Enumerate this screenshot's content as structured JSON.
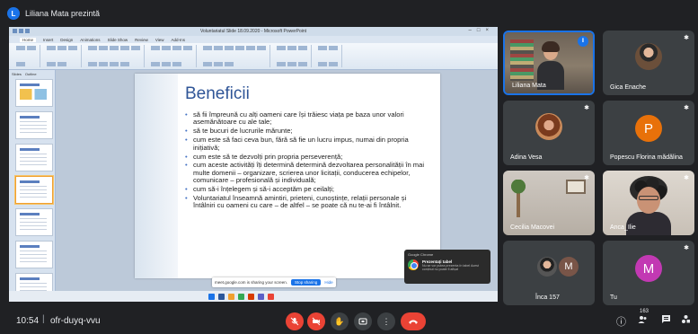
{
  "presenter": {
    "initial": "L",
    "label": "Liliana Mata prezintă"
  },
  "screen_share": {
    "window_title": "Voluntariatul Slide 18.09.2020 - Microsoft PowerPoint",
    "ribbon_tabs": [
      "Home",
      "Insert",
      "Design",
      "Animations",
      "Slide Show",
      "Review",
      "View",
      "Add-Ins"
    ],
    "panel_tabs": [
      "Slides",
      "Outline"
    ],
    "slide": {
      "title": "Beneficii",
      "bullets": [
        "să fii împreună cu alți oameni care își trăiesc viața pe baza unor valori asemănătoare cu ale tale;",
        "să te bucuri de lucrurile mărunte;",
        "cum este să faci ceva bun, fără să fie un lucru impus, numai din propria inițiativă;",
        "cum este să te dezvolți prin propria perseverență;",
        "cum aceste activități îți determină determină dezvoltarea personalității în mai multe domenii – organizare, scrierea unor licitații, conducerea echipelor, comunicare – profesională și individuală;",
        "cum să-i înțelegem și să-i acceptăm pe ceilalți;",
        "Voluntariatul înseamnă amintiri, prieteni, cunoștințe, relații personale și întâlniri cu oameni cu care – de altfel – se poate că nu te-ai fi întâlnit."
      ]
    },
    "share_banner": {
      "text": "meet.google.com is sharing your screen.",
      "stop_label": "Stop sharing",
      "hide_label": "Hide"
    },
    "notification": {
      "app": "Google Chrome",
      "title": "Prezentați tabel",
      "text": "Nu se vor putea prezenta în tabel Acest conținut nu poate fi afișat"
    },
    "taskbar_icon_colors": [
      "#1a73e8",
      "#2b579a",
      "#f0a030",
      "#34a853",
      "#d83b01",
      "#5b5fc7",
      "#ea4335"
    ]
  },
  "participants": [
    {
      "name": "Liliana Mata",
      "type": "camera",
      "speaking": true
    },
    {
      "name": "Gica Enache",
      "type": "photo"
    },
    {
      "name": "Adina Vesa",
      "type": "photo"
    },
    {
      "name": "Popescu Florina mădălina",
      "type": "letter",
      "initial": "P",
      "color": "#e8710a"
    },
    {
      "name": "Cecilia Macovei",
      "type": "camera2"
    },
    {
      "name": "Anca_Ilie",
      "type": "camera3"
    },
    {
      "name": "Înca 157",
      "type": "group",
      "initial": "M",
      "color": "#795548"
    },
    {
      "name": "Tu",
      "type": "letter",
      "initial": "M",
      "color": "#c239b3"
    }
  ],
  "bottom_bar": {
    "time": "10:54",
    "separator": "|",
    "meeting_code": "ofr-duyq-vvu",
    "people_count": "163"
  },
  "icons": {
    "mic": "mic-off-icon",
    "camera": "camera-off-icon",
    "hand": "raise-hand-icon",
    "present": "present-icon",
    "more": "more-options-icon",
    "end": "end-call-icon",
    "info": "info-icon",
    "people": "people-icon",
    "chat": "chat-icon",
    "activities": "activities-icon",
    "pin": "pin-icon"
  }
}
